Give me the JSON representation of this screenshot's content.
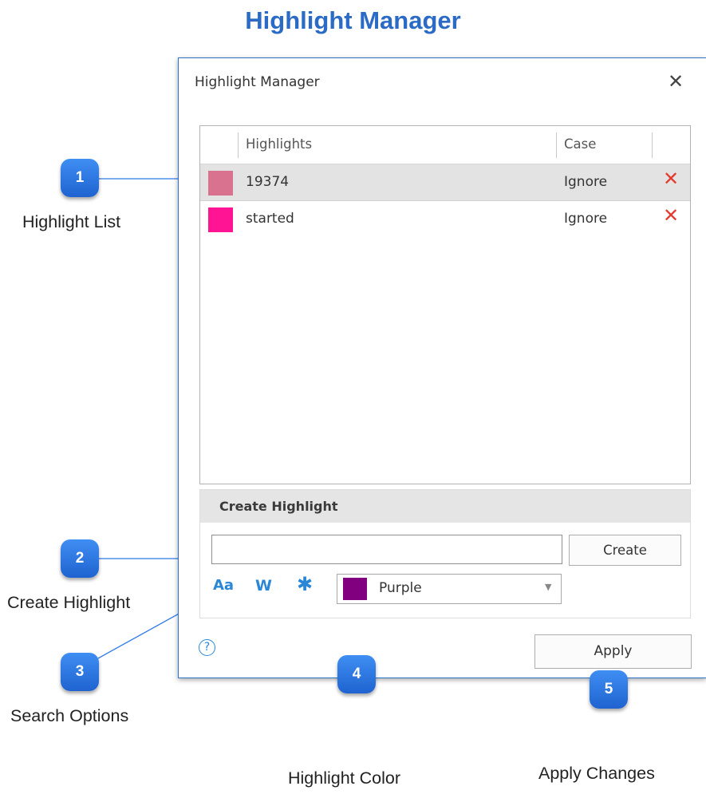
{
  "page_title": "Highlight Manager",
  "dialog": {
    "title": "Highlight Manager",
    "close_glyph": "✕",
    "list": {
      "columns": [
        "Highlights",
        "Case"
      ],
      "rows": [
        {
          "text": "19374",
          "case": "Ignore",
          "color": "#d9728f",
          "selected": true
        },
        {
          "text": "started",
          "case": "Ignore",
          "color": "#ff1493",
          "selected": false
        }
      ],
      "delete_glyph": "✕"
    },
    "create": {
      "heading": "Create Highlight",
      "input_value": "",
      "create_button": "Create",
      "options": {
        "match_case": "Aa",
        "whole_word": "W",
        "regex": "✱"
      },
      "color_select": {
        "value": "Purple",
        "color": "#800080"
      }
    },
    "help_glyph": "?",
    "apply_button": "Apply"
  },
  "callouts": [
    {
      "number": "1",
      "label": "Highlight List"
    },
    {
      "number": "2",
      "label": "Create Highlight"
    },
    {
      "number": "3",
      "label": "Search Options"
    },
    {
      "number": "4",
      "label": "Highlight Color"
    },
    {
      "number": "5",
      "label": "Apply Changes"
    }
  ],
  "colors": {
    "accent": "#2b6bc5",
    "badge": "#2d7ae8",
    "delete": "#e53a2f",
    "option_icons": "#2a87d6"
  }
}
